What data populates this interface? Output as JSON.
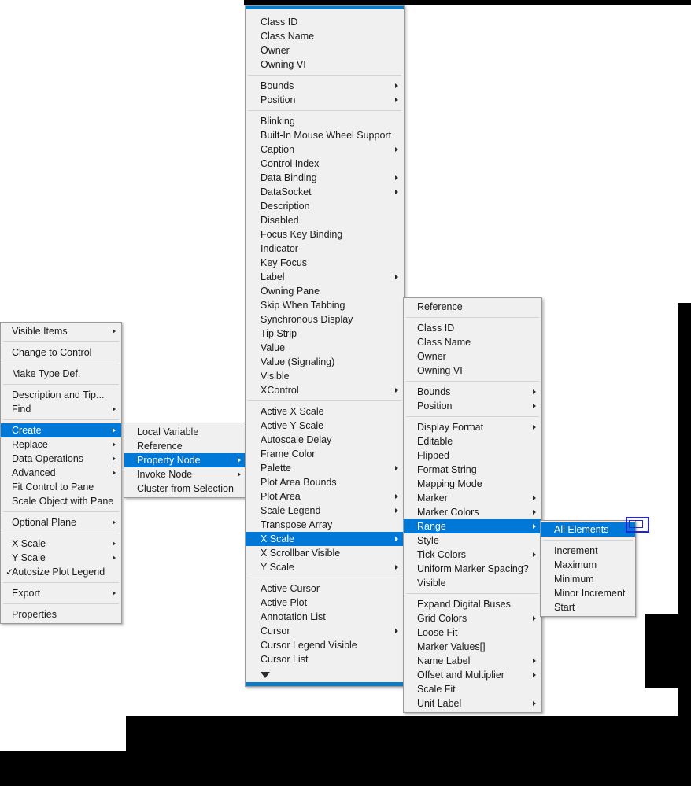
{
  "app": {
    "title": "LabVIEW front panel context menu cascade",
    "accent_color": "#0078d7",
    "menu_background": "#f0f0f0",
    "menu_border": "#9a9a9a",
    "separator_color": "#d3d3d3",
    "scroll_indicator_color": "#0f7bc4",
    "focus_rect_color": "#2222dd"
  },
  "menus": {
    "context": {
      "name": "object-context-menu",
      "groups": [
        {
          "items": [
            {
              "label": "Visible Items",
              "submenu": true,
              "checked": false,
              "selected": false
            }
          ]
        },
        {
          "items": [
            {
              "label": "Change to Control",
              "submenu": false,
              "checked": false,
              "selected": false
            }
          ]
        },
        {
          "items": [
            {
              "label": "Make Type Def.",
              "submenu": false,
              "checked": false,
              "selected": false
            }
          ]
        },
        {
          "items": [
            {
              "label": "Description and Tip...",
              "submenu": false,
              "checked": false,
              "selected": false
            },
            {
              "label": "Find",
              "submenu": true,
              "checked": false,
              "selected": false
            }
          ]
        },
        {
          "items": [
            {
              "label": "Create",
              "submenu": true,
              "checked": false,
              "selected": true
            },
            {
              "label": "Replace",
              "submenu": true,
              "checked": false,
              "selected": false
            },
            {
              "label": "Data Operations",
              "submenu": true,
              "checked": false,
              "selected": false
            },
            {
              "label": "Advanced",
              "submenu": true,
              "checked": false,
              "selected": false
            },
            {
              "label": "Fit Control to Pane",
              "submenu": false,
              "checked": false,
              "selected": false
            },
            {
              "label": "Scale Object with Pane",
              "submenu": false,
              "checked": false,
              "selected": false
            }
          ]
        },
        {
          "items": [
            {
              "label": "Optional Plane",
              "submenu": true,
              "checked": false,
              "selected": false
            }
          ]
        },
        {
          "items": [
            {
              "label": "X Scale",
              "submenu": true,
              "checked": false,
              "selected": false
            },
            {
              "label": "Y Scale",
              "submenu": true,
              "checked": false,
              "selected": false
            },
            {
              "label": "Autosize Plot Legend",
              "submenu": false,
              "checked": true,
              "selected": false
            }
          ]
        },
        {
          "items": [
            {
              "label": "Export",
              "submenu": true,
              "checked": false,
              "selected": false
            }
          ]
        },
        {
          "items": [
            {
              "label": "Properties",
              "submenu": false,
              "checked": false,
              "selected": false
            }
          ]
        }
      ]
    },
    "create": {
      "name": "create-submenu",
      "groups": [
        {
          "items": [
            {
              "label": "Local Variable",
              "submenu": false,
              "checked": false,
              "selected": false
            },
            {
              "label": "Reference",
              "submenu": false,
              "checked": false,
              "selected": false
            },
            {
              "label": "Property Node",
              "submenu": true,
              "checked": false,
              "selected": true
            },
            {
              "label": "Invoke Node",
              "submenu": true,
              "checked": false,
              "selected": false
            },
            {
              "label": "Cluster from Selection",
              "submenu": false,
              "checked": false,
              "selected": false
            }
          ]
        }
      ]
    },
    "property_node": {
      "name": "property-node-submenu",
      "scroll_up_indicator": true,
      "scroll_down_arrow": true,
      "groups": [
        {
          "items": [
            {
              "label": "Class ID",
              "submenu": false,
              "checked": false,
              "selected": false
            },
            {
              "label": "Class Name",
              "submenu": false,
              "checked": false,
              "selected": false
            },
            {
              "label": "Owner",
              "submenu": false,
              "checked": false,
              "selected": false
            },
            {
              "label": "Owning VI",
              "submenu": false,
              "checked": false,
              "selected": false
            }
          ]
        },
        {
          "items": [
            {
              "label": "Bounds",
              "submenu": true,
              "checked": false,
              "selected": false
            },
            {
              "label": "Position",
              "submenu": true,
              "checked": false,
              "selected": false
            }
          ]
        },
        {
          "items": [
            {
              "label": "Blinking",
              "submenu": false,
              "checked": false,
              "selected": false
            },
            {
              "label": "Built-In Mouse Wheel Support",
              "submenu": false,
              "checked": false,
              "selected": false
            },
            {
              "label": "Caption",
              "submenu": true,
              "checked": false,
              "selected": false
            },
            {
              "label": "Control Index",
              "submenu": false,
              "checked": false,
              "selected": false
            },
            {
              "label": "Data Binding",
              "submenu": true,
              "checked": false,
              "selected": false
            },
            {
              "label": "DataSocket",
              "submenu": true,
              "checked": false,
              "selected": false
            },
            {
              "label": "Description",
              "submenu": false,
              "checked": false,
              "selected": false
            },
            {
              "label": "Disabled",
              "submenu": false,
              "checked": false,
              "selected": false
            },
            {
              "label": "Focus Key Binding",
              "submenu": false,
              "checked": false,
              "selected": false
            },
            {
              "label": "Indicator",
              "submenu": false,
              "checked": false,
              "selected": false
            },
            {
              "label": "Key Focus",
              "submenu": false,
              "checked": false,
              "selected": false
            },
            {
              "label": "Label",
              "submenu": true,
              "checked": false,
              "selected": false
            },
            {
              "label": "Owning Pane",
              "submenu": false,
              "checked": false,
              "selected": false
            },
            {
              "label": "Skip When Tabbing",
              "submenu": false,
              "checked": false,
              "selected": false
            },
            {
              "label": "Synchronous Display",
              "submenu": false,
              "checked": false,
              "selected": false
            },
            {
              "label": "Tip Strip",
              "submenu": false,
              "checked": false,
              "selected": false
            },
            {
              "label": "Value",
              "submenu": false,
              "checked": false,
              "selected": false
            },
            {
              "label": "Value (Signaling)",
              "submenu": false,
              "checked": false,
              "selected": false
            },
            {
              "label": "Visible",
              "submenu": false,
              "checked": false,
              "selected": false
            },
            {
              "label": "XControl",
              "submenu": true,
              "checked": false,
              "selected": false
            }
          ]
        },
        {
          "items": [
            {
              "label": "Active X Scale",
              "submenu": false,
              "checked": false,
              "selected": false
            },
            {
              "label": "Active Y Scale",
              "submenu": false,
              "checked": false,
              "selected": false
            },
            {
              "label": "Autoscale Delay",
              "submenu": false,
              "checked": false,
              "selected": false
            },
            {
              "label": "Frame Color",
              "submenu": false,
              "checked": false,
              "selected": false
            },
            {
              "label": "Palette",
              "submenu": true,
              "checked": false,
              "selected": false
            },
            {
              "label": "Plot Area Bounds",
              "submenu": false,
              "checked": false,
              "selected": false
            },
            {
              "label": "Plot Area",
              "submenu": true,
              "checked": false,
              "selected": false
            },
            {
              "label": "Scale Legend",
              "submenu": true,
              "checked": false,
              "selected": false
            },
            {
              "label": "Transpose Array",
              "submenu": false,
              "checked": false,
              "selected": false
            },
            {
              "label": "X Scale",
              "submenu": true,
              "checked": false,
              "selected": true
            },
            {
              "label": "X Scrollbar Visible",
              "submenu": false,
              "checked": false,
              "selected": false
            },
            {
              "label": "Y Scale",
              "submenu": true,
              "checked": false,
              "selected": false
            }
          ]
        },
        {
          "items": [
            {
              "label": "Active Cursor",
              "submenu": false,
              "checked": false,
              "selected": false
            },
            {
              "label": "Active Plot",
              "submenu": false,
              "checked": false,
              "selected": false
            },
            {
              "label": "Annotation List",
              "submenu": false,
              "checked": false,
              "selected": false
            },
            {
              "label": "Cursor",
              "submenu": true,
              "checked": false,
              "selected": false
            },
            {
              "label": "Cursor Legend Visible",
              "submenu": false,
              "checked": false,
              "selected": false
            },
            {
              "label": "Cursor List",
              "submenu": false,
              "checked": false,
              "selected": false
            }
          ]
        }
      ]
    },
    "x_scale": {
      "name": "x-scale-submenu",
      "groups": [
        {
          "items": [
            {
              "label": "Reference",
              "submenu": false,
              "checked": false,
              "selected": false
            }
          ]
        },
        {
          "items": [
            {
              "label": "Class ID",
              "submenu": false,
              "checked": false,
              "selected": false
            },
            {
              "label": "Class Name",
              "submenu": false,
              "checked": false,
              "selected": false
            },
            {
              "label": "Owner",
              "submenu": false,
              "checked": false,
              "selected": false
            },
            {
              "label": "Owning VI",
              "submenu": false,
              "checked": false,
              "selected": false
            }
          ]
        },
        {
          "items": [
            {
              "label": "Bounds",
              "submenu": true,
              "checked": false,
              "selected": false
            },
            {
              "label": "Position",
              "submenu": true,
              "checked": false,
              "selected": false
            }
          ]
        },
        {
          "items": [
            {
              "label": "Display Format",
              "submenu": true,
              "checked": false,
              "selected": false
            },
            {
              "label": "Editable",
              "submenu": false,
              "checked": false,
              "selected": false
            },
            {
              "label": "Flipped",
              "submenu": false,
              "checked": false,
              "selected": false
            },
            {
              "label": "Format String",
              "submenu": false,
              "checked": false,
              "selected": false
            },
            {
              "label": "Mapping Mode",
              "submenu": false,
              "checked": false,
              "selected": false
            },
            {
              "label": "Marker",
              "submenu": true,
              "checked": false,
              "selected": false
            },
            {
              "label": "Marker Colors",
              "submenu": true,
              "checked": false,
              "selected": false
            },
            {
              "label": "Range",
              "submenu": true,
              "checked": false,
              "selected": true
            },
            {
              "label": "Style",
              "submenu": false,
              "checked": false,
              "selected": false
            },
            {
              "label": "Tick Colors",
              "submenu": true,
              "checked": false,
              "selected": false
            },
            {
              "label": "Uniform Marker Spacing?",
              "submenu": false,
              "checked": false,
              "selected": false
            },
            {
              "label": "Visible",
              "submenu": false,
              "checked": false,
              "selected": false
            }
          ]
        },
        {
          "items": [
            {
              "label": "Expand Digital Buses",
              "submenu": false,
              "checked": false,
              "selected": false
            },
            {
              "label": "Grid Colors",
              "submenu": true,
              "checked": false,
              "selected": false
            },
            {
              "label": "Loose Fit",
              "submenu": false,
              "checked": false,
              "selected": false
            },
            {
              "label": "Marker Values[]",
              "submenu": false,
              "checked": false,
              "selected": false
            },
            {
              "label": "Name Label",
              "submenu": true,
              "checked": false,
              "selected": false
            },
            {
              "label": "Offset and Multiplier",
              "submenu": true,
              "checked": false,
              "selected": false
            },
            {
              "label": "Scale Fit",
              "submenu": false,
              "checked": false,
              "selected": false
            },
            {
              "label": "Unit Label",
              "submenu": true,
              "checked": false,
              "selected": false
            }
          ]
        }
      ]
    },
    "range": {
      "name": "range-submenu",
      "groups": [
        {
          "items": [
            {
              "label": "All Elements",
              "submenu": false,
              "checked": false,
              "selected": true
            }
          ]
        },
        {
          "items": [
            {
              "label": "Increment",
              "submenu": false,
              "checked": false,
              "selected": false
            },
            {
              "label": "Maximum",
              "submenu": false,
              "checked": false,
              "selected": false
            },
            {
              "label": "Minimum",
              "submenu": false,
              "checked": false,
              "selected": false
            },
            {
              "label": "Minor Increment",
              "submenu": false,
              "checked": false,
              "selected": false
            },
            {
              "label": "Start",
              "submenu": false,
              "checked": false,
              "selected": false
            }
          ]
        }
      ]
    }
  },
  "icons": {
    "submenu_arrow": "chevron-right-icon",
    "checkmark": "check-icon",
    "scroll_down": "triangle-down-icon"
  }
}
